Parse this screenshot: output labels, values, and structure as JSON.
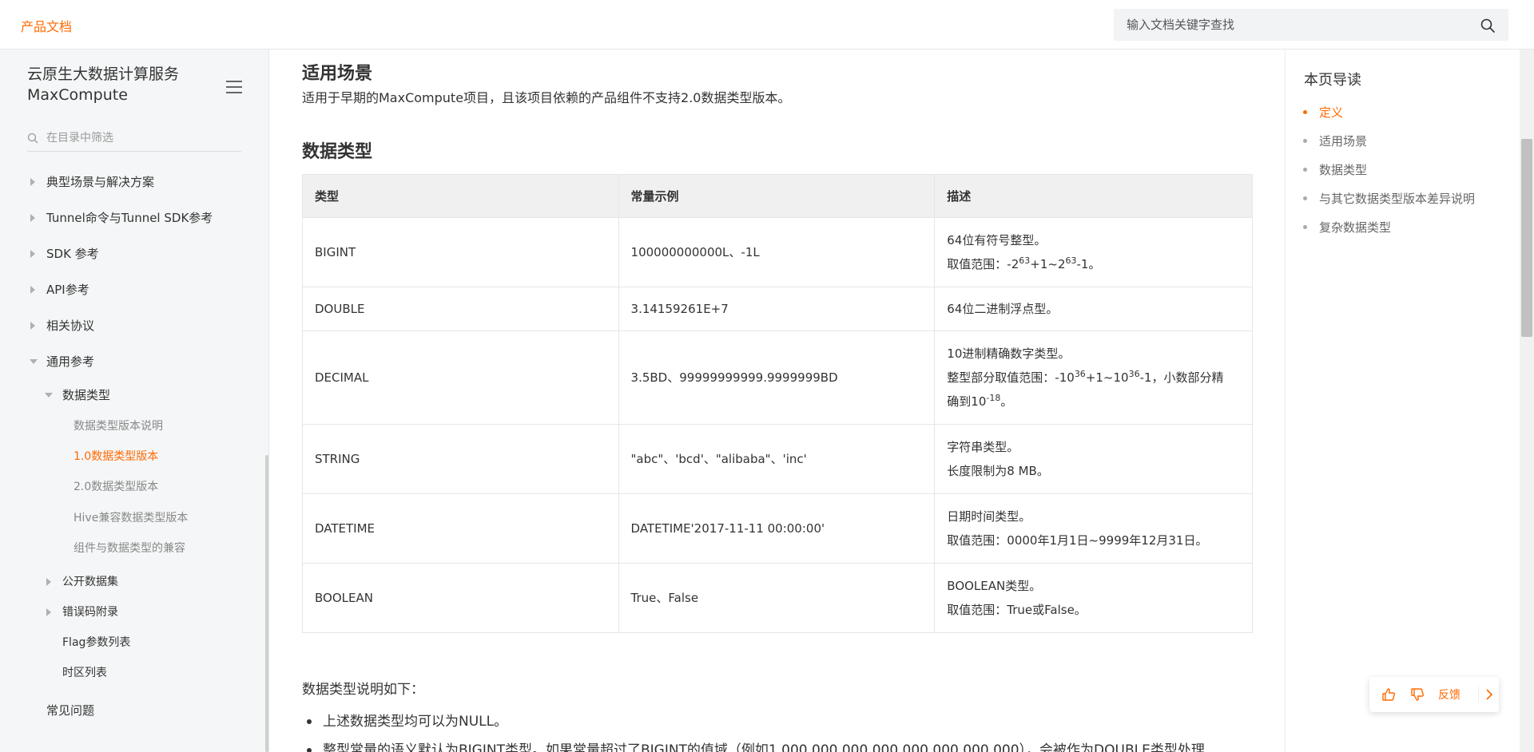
{
  "header": {
    "brand": "产品文档",
    "search_placeholder": "输入文档关键字查找"
  },
  "sidebar": {
    "title": "云原生大数据计算服务 MaxCompute",
    "filter_placeholder": "在目录中筛选",
    "items": [
      {
        "label": "典型场景与解决方案"
      },
      {
        "label": "Tunnel命令与Tunnel SDK参考"
      },
      {
        "label": "SDK 参考"
      },
      {
        "label": "API参考"
      },
      {
        "label": "相关协议"
      },
      {
        "label": "通用参考"
      },
      {
        "label": "数据类型"
      },
      {
        "label": "数据类型版本说明"
      },
      {
        "label": "1.0数据类型版本"
      },
      {
        "label": "2.0数据类型版本"
      },
      {
        "label": "Hive兼容数据类型版本"
      },
      {
        "label": "组件与数据类型的兼容"
      },
      {
        "label": "公开数据集"
      },
      {
        "label": "错误码附录"
      },
      {
        "label": "Flag参数列表"
      },
      {
        "label": "时区列表"
      },
      {
        "label": "常见问题"
      }
    ]
  },
  "content": {
    "section1_title": "适用场景",
    "section1_text": "适用于早期的MaxCompute项目，且该项目依赖的产品组件不支持2.0数据类型版本。",
    "section2_title": "数据类型",
    "table": {
      "headers": [
        "类型",
        "常量示例",
        "描述"
      ],
      "rows": [
        {
          "type": "BIGINT",
          "example": "100000000000L、-1L",
          "desc1": "64位有符号整型。",
          "desc2_pre": "取值范围：-2",
          "sup1": "63",
          "desc2_mid": "+1~2",
          "sup2": "63",
          "desc2_post": "-1。"
        },
        {
          "type": "DOUBLE",
          "example": "3.14159261E+7",
          "desc1": "64位二进制浮点型。"
        },
        {
          "type": "DECIMAL",
          "example": "3.5BD、99999999999.9999999BD",
          "desc1": "10进制精确数字类型。",
          "desc2_pre": "整型部分取值范围：-10",
          "sup1": "36",
          "desc2_mid": "+1~10",
          "sup2": "36",
          "desc2_post": "-1，小数部分精",
          "desc3_pre": "确到10",
          "sup3": "-18",
          "desc3_post": "。"
        },
        {
          "type": "STRING",
          "example": "\"abc\"、'bcd'、\"alibaba\"、'inc'",
          "desc1": "字符串类型。",
          "desc2": "长度限制为8 MB。"
        },
        {
          "type": "DATETIME",
          "example": "DATETIME'2017-11-11 00:00:00'",
          "desc1": "日期时间类型。",
          "desc2": "取值范围：0000年1月1日~9999年12月31日。"
        },
        {
          "type": "BOOLEAN",
          "example": "True、False",
          "desc1": "BOOLEAN类型。",
          "desc2": "取值范围：True或False。"
        }
      ]
    },
    "notes_intro": "数据类型说明如下：",
    "notes": [
      "上述数据类型均可以为NULL。",
      "整型常量的语义默认为BIGINT类型。如果常量超过了BIGINT的值域（例如1,000,000,000,000,000,000,000,000），会被作为DOUBLE类型处理"
    ]
  },
  "toc": {
    "title": "本页导读",
    "items": [
      {
        "label": "定义",
        "active": true
      },
      {
        "label": "适用场景"
      },
      {
        "label": "数据类型"
      },
      {
        "label": "与其它数据类型版本差异说明"
      },
      {
        "label": "复杂数据类型"
      }
    ]
  },
  "feedback": {
    "label": "反馈",
    "accent": "#ff6a00"
  },
  "icons": [
    "search-icon",
    "menu-icon",
    "filter-search-icon",
    "thumb-up-icon",
    "thumb-down-icon",
    "chevron-right-icon"
  ]
}
